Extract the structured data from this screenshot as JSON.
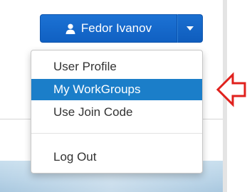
{
  "user_menu": {
    "user_name": "Fedor Ivanov",
    "icons": {
      "user": "user-icon",
      "caret": "caret-down-icon",
      "pointer": "red-arrow-left-icon"
    },
    "items": [
      {
        "label": "User Profile"
      },
      {
        "label": "My WorkGroups",
        "highlighted": true
      },
      {
        "label": "Use Join Code"
      },
      {
        "label": "Log Out"
      }
    ]
  },
  "colors": {
    "button_blue": "#1367c9",
    "highlight_blue": "#1b7ec9",
    "arrow_red": "#e0211d"
  }
}
